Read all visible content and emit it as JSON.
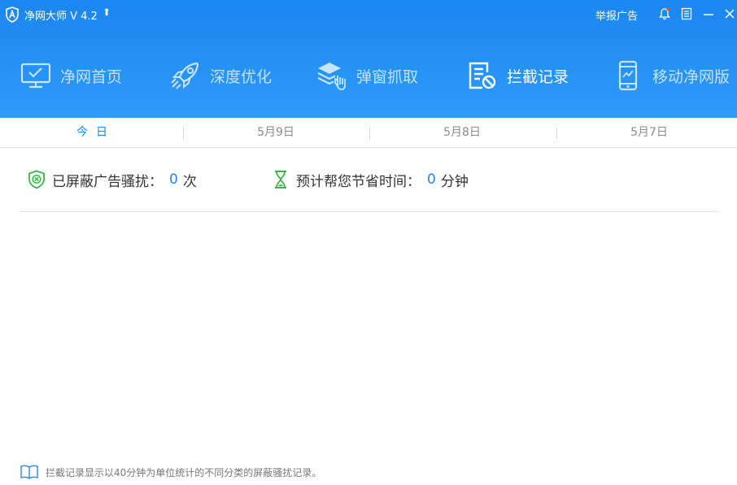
{
  "titlebar": {
    "app_title": "净网大师 V 4.2",
    "upgrade_icon": "up-arrow-icon",
    "report_label": "举报广告",
    "bell_icon": "bell-icon",
    "menu_icon": "menu-icon",
    "minimize_icon": "minimize-icon",
    "close_icon": "close-icon"
  },
  "nav": {
    "items": [
      {
        "label": "净网首页",
        "icon": "monitor-icon"
      },
      {
        "label": "深度优化",
        "icon": "rocket-icon"
      },
      {
        "label": "弹窗抓取",
        "icon": "layers-hand-icon"
      },
      {
        "label": "拦截记录",
        "icon": "record-block-icon",
        "active": true
      },
      {
        "label": "移动净网版",
        "icon": "phone-icon"
      }
    ]
  },
  "date_tabs": [
    {
      "label": "今日",
      "active": true
    },
    {
      "label": "5月9日"
    },
    {
      "label": "5月8日"
    },
    {
      "label": "5月7日"
    }
  ],
  "stats": {
    "blocked": {
      "label": "已屏蔽广告骚扰：",
      "value": "0",
      "unit": "次",
      "icon": "shield-x-icon"
    },
    "saved": {
      "label": "预计帮您节省时间：",
      "value": "0",
      "unit": "分钟",
      "icon": "hourglass-icon"
    }
  },
  "footer": {
    "icon": "book-icon",
    "text": "拦截记录显示以40分钟为单位统计的不同分类的屏蔽骚扰记录。"
  },
  "colors": {
    "header_blue": "#1a86f0",
    "accent_blue": "#1e86f0",
    "green_icon": "#3cb449"
  }
}
